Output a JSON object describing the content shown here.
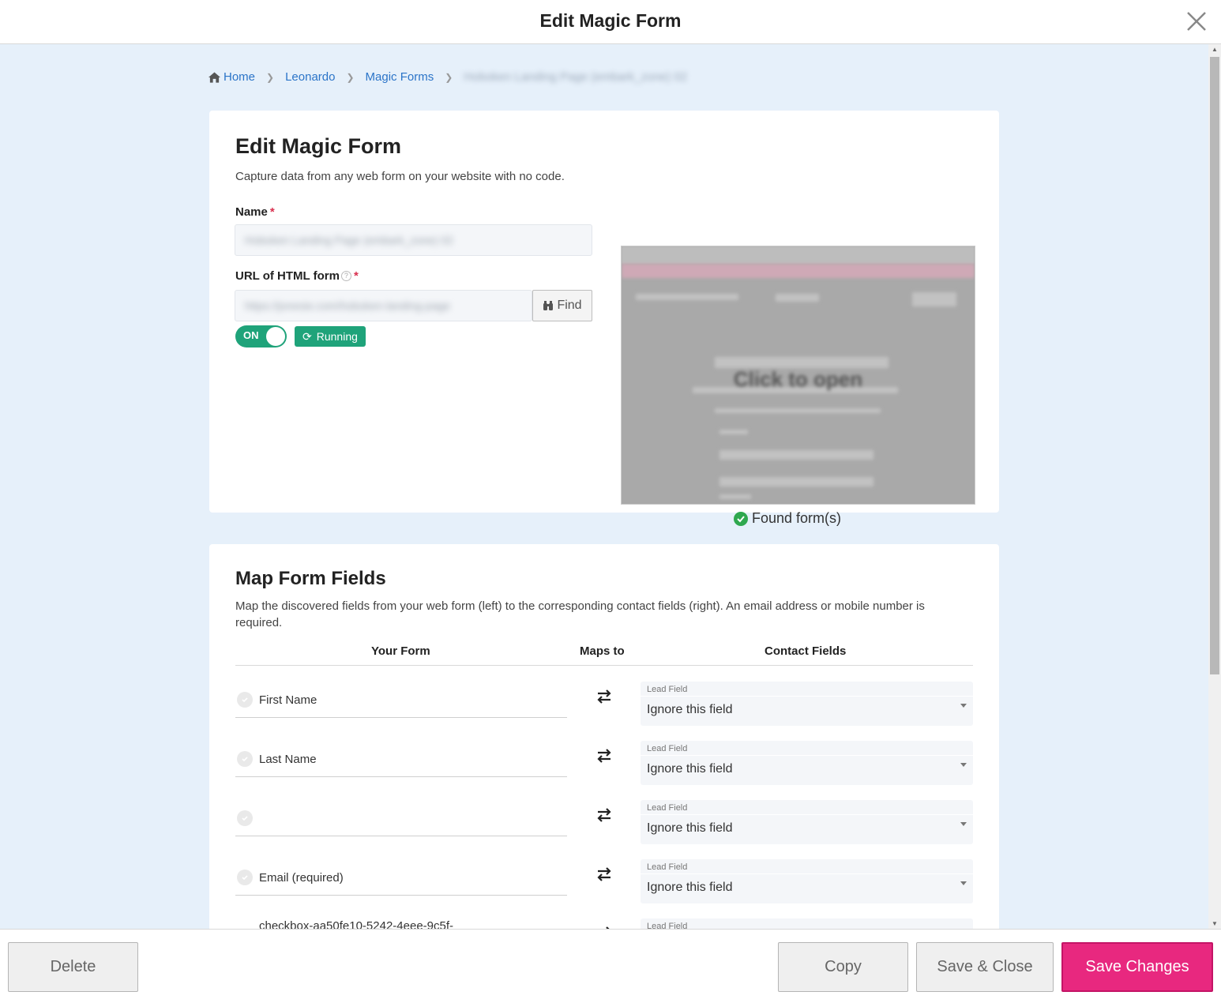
{
  "header": {
    "title": "Edit Magic Form"
  },
  "breadcrumb": {
    "home": "Home",
    "items": [
      "Leonardo",
      "Magic Forms"
    ],
    "current": "Hoboken Landing Page (embark_zone) 02"
  },
  "form_card": {
    "title": "Edit Magic Form",
    "subtitle": "Capture data from any web form on your website with no code.",
    "name_label": "Name",
    "name_value": "Hoboken Landing Page (embark_zone) 02",
    "url_label": "URL of HTML form",
    "url_value": "https://jonesie.com/hoboken-landing-page",
    "find_label": "Find",
    "toggle_label": "ON",
    "status_label": "Running",
    "preview_text": "Click to open",
    "found_label": "Found form(s)",
    "required_mark": "*",
    "help_mark": "?"
  },
  "map_card": {
    "title": "Map Form Fields",
    "subtitle": "Map the discovered fields from your web form (left) to the corresponding contact fields (right). An email address or mobile number is required.",
    "col_your_form": "Your Form",
    "col_maps_to": "Maps to",
    "col_contact_fields": "Contact Fields",
    "rows": [
      {
        "field": "First Name",
        "select_label": "Lead Field",
        "select_value": "Ignore this field"
      },
      {
        "field": "Last Name",
        "select_label": "Lead Field",
        "select_value": "Ignore this field"
      },
      {
        "field": "",
        "select_label": "Lead Field",
        "select_value": "Ignore this field"
      },
      {
        "field": "Email (required)",
        "select_label": "Lead Field",
        "select_value": "Ignore this field"
      },
      {
        "field": "checkbox-aa50fe10-5242-4eee-9c5f-",
        "select_label": "Lead Field",
        "select_value": ""
      }
    ]
  },
  "footer": {
    "delete": "Delete",
    "copy": "Copy",
    "save_close": "Save & Close",
    "save_changes": "Save Changes"
  },
  "colors": {
    "accent": "#e8287f",
    "running": "#1fa37a",
    "link": "#2b74c8",
    "background": "#e6f0fa"
  }
}
